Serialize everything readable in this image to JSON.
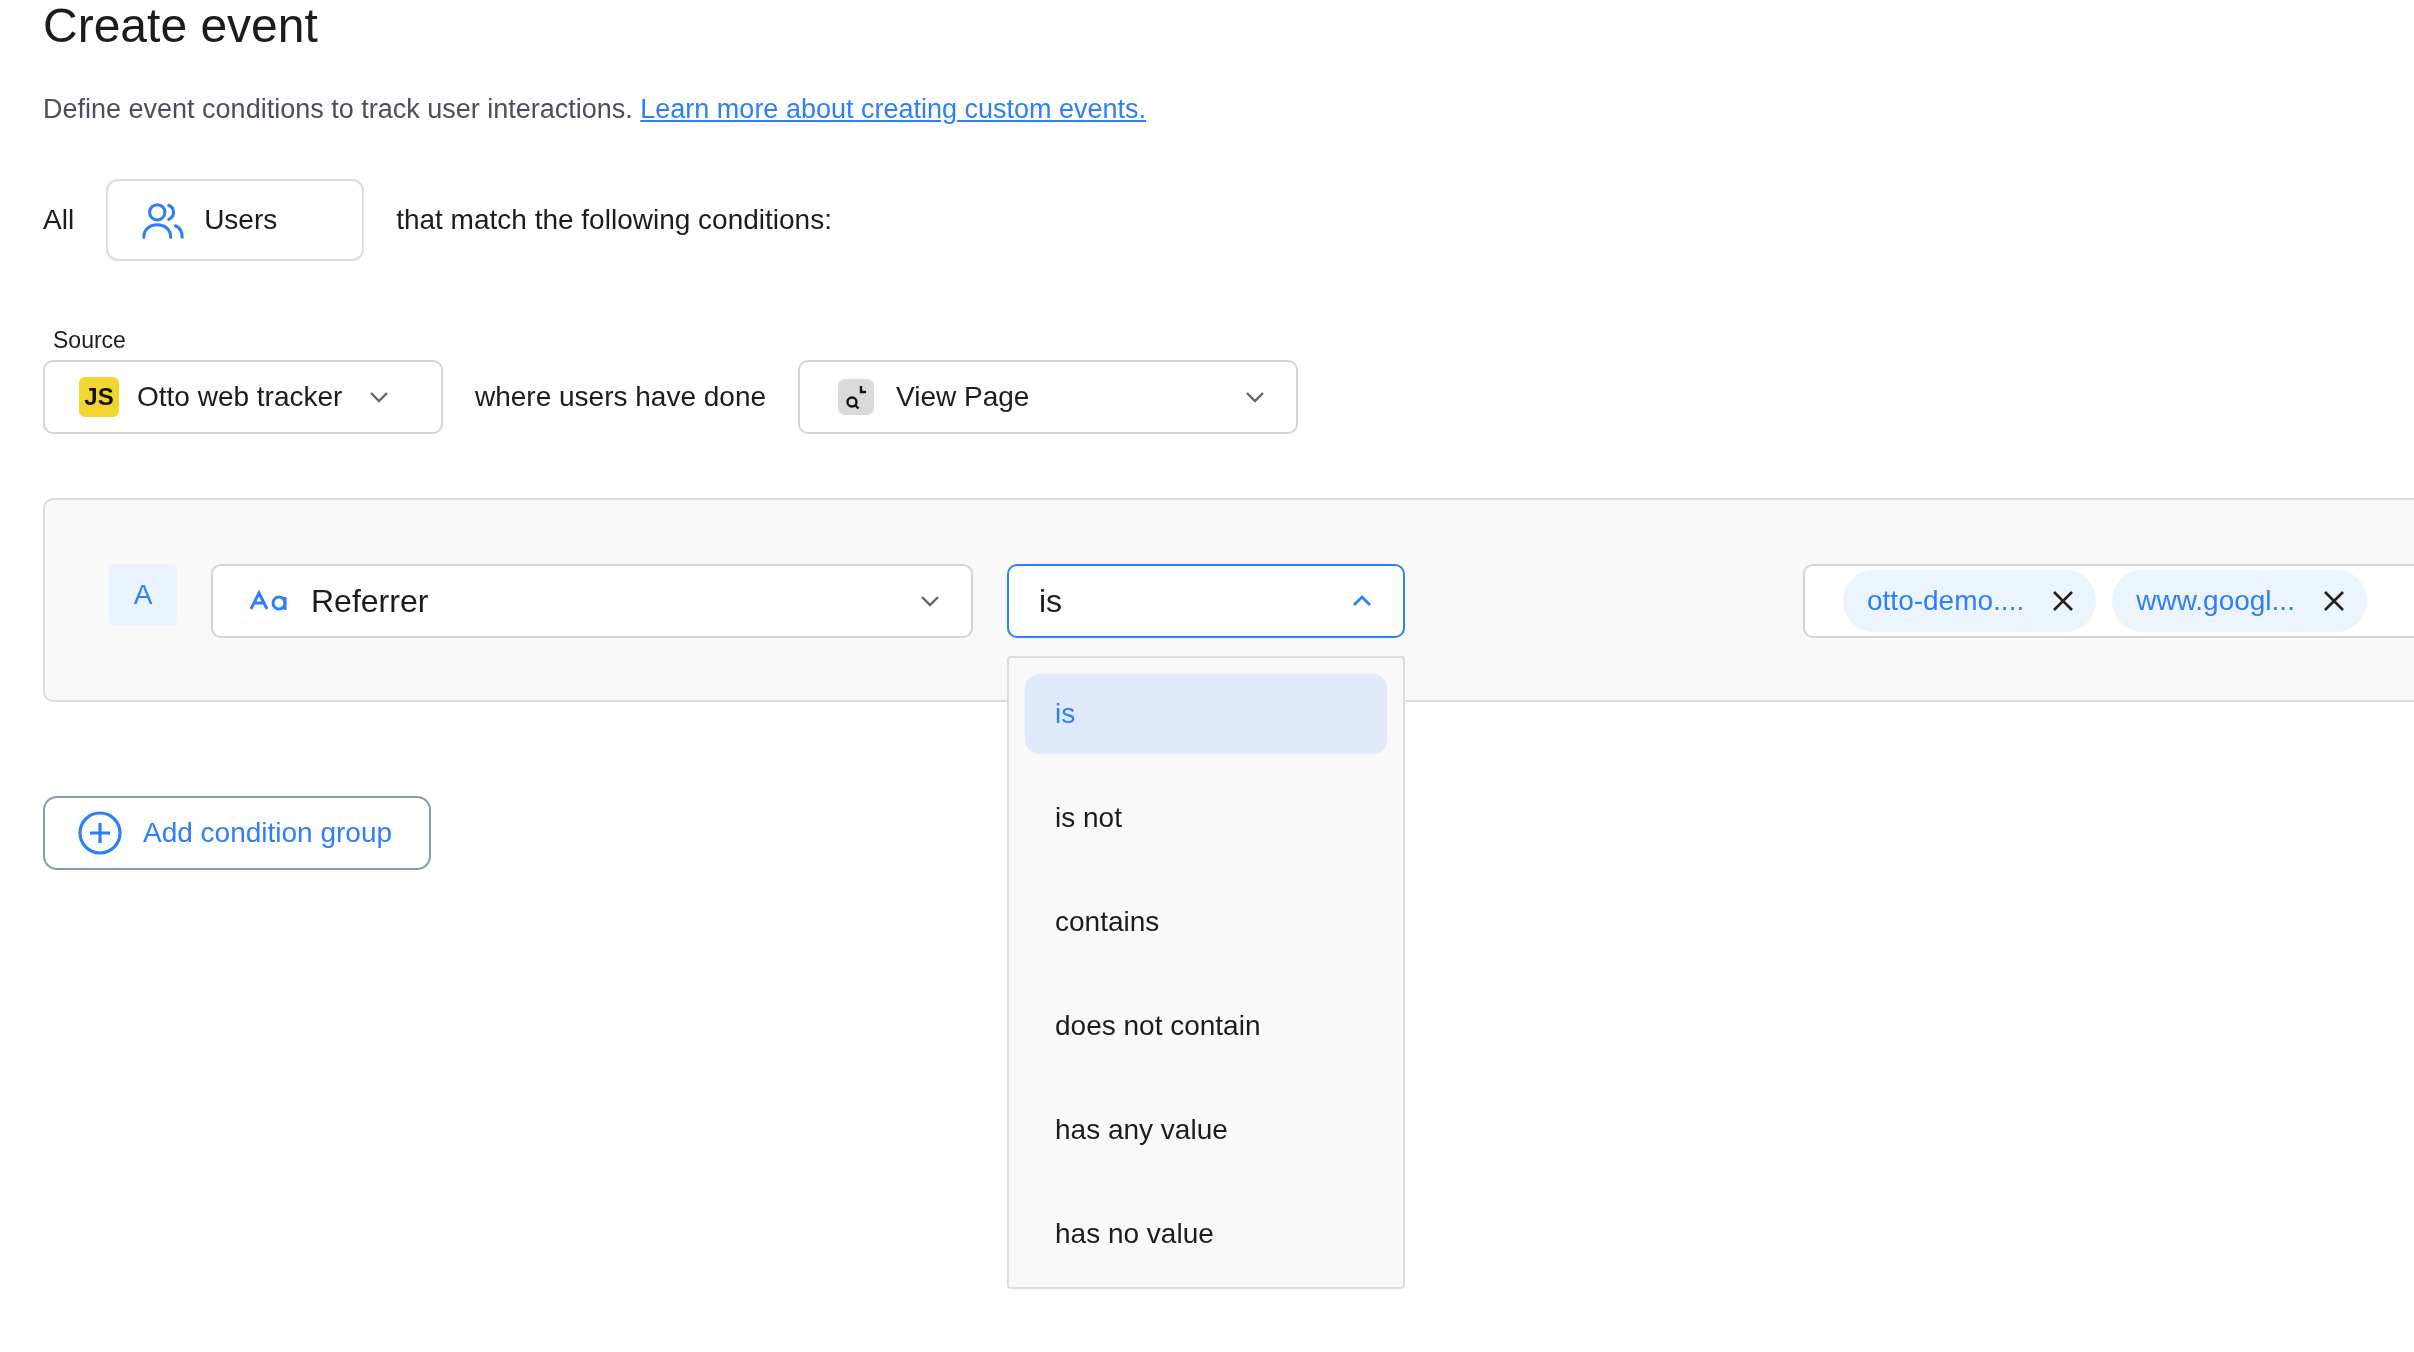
{
  "title": "Create event",
  "description": {
    "text": "Define event conditions to track user interactions.",
    "link": "Learn more about creating custom events."
  },
  "audience": {
    "prefix": "All",
    "entity": "Users",
    "suffix": "that match the following conditions:"
  },
  "source": {
    "label": "Source",
    "badge": "JS",
    "value": "Otto web tracker"
  },
  "connector": "where users have done",
  "event": {
    "value": "View Page"
  },
  "condition_group": {
    "letter": "A",
    "property": "Referrer",
    "operator": {
      "value": "is",
      "expanded": true,
      "options": [
        {
          "label": "is",
          "selected": true
        },
        {
          "label": "is not",
          "selected": false
        },
        {
          "label": "contains",
          "selected": false
        },
        {
          "label": "does not contain",
          "selected": false
        },
        {
          "label": "has any value",
          "selected": false
        },
        {
          "label": "has no value",
          "selected": false
        }
      ]
    },
    "values": [
      "otto-demo....",
      "www.googl..."
    ]
  },
  "add_button": "Add condition group"
}
